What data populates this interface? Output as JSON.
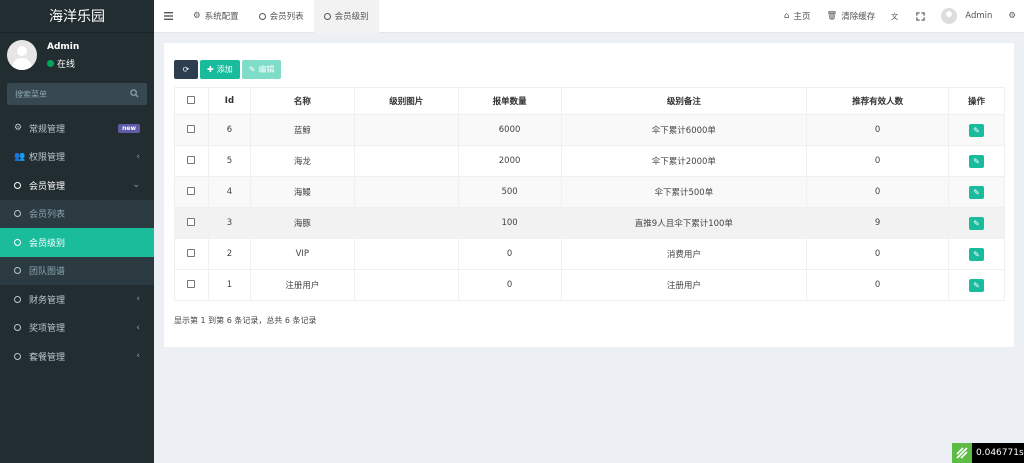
{
  "brand": "海洋乐园",
  "user": {
    "name": "Admin",
    "status": "在线"
  },
  "search": {
    "placeholder": "搜索菜单"
  },
  "menu": [
    {
      "label": "常规管理",
      "icon": "gears-icon",
      "badge": "new"
    },
    {
      "label": "权限管理",
      "icon": "group-icon",
      "arrow": "‹"
    },
    {
      "label": "会员管理",
      "icon": "circle-icon",
      "arrow": "⌄"
    },
    {
      "label": "会员列表",
      "icon": "circle-icon"
    },
    {
      "label": "会员级别",
      "icon": "circle-icon"
    },
    {
      "label": "团队图谱",
      "icon": "circle-icon"
    },
    {
      "label": "财务管理",
      "icon": "circle-icon",
      "arrow": "‹"
    },
    {
      "label": "奖项管理",
      "icon": "circle-icon",
      "arrow": "‹"
    },
    {
      "label": "套餐管理",
      "icon": "circle-icon",
      "arrow": "‹"
    }
  ],
  "tabs": [
    {
      "label": "系统配置"
    },
    {
      "label": "会员列表"
    },
    {
      "label": "会员级别"
    }
  ],
  "topright": {
    "home": "主页",
    "clear_cache": "清除缓存",
    "admin": "Admin"
  },
  "toolbar": {
    "add": "添加",
    "edit": "编辑"
  },
  "table": {
    "headers": [
      "Id",
      "名称",
      "级别图片",
      "报单数量",
      "级别备注",
      "推荐有效人数",
      "操作"
    ],
    "rows": [
      {
        "id": "6",
        "name": "蓝鲸",
        "img": "",
        "qty": "6000",
        "note": "伞下累计6000单",
        "refs": "0"
      },
      {
        "id": "5",
        "name": "海龙",
        "img": "",
        "qty": "2000",
        "note": "伞下累计2000单",
        "refs": "0"
      },
      {
        "id": "4",
        "name": "海鳗",
        "img": "",
        "qty": "500",
        "note": "伞下累计500单",
        "refs": "0"
      },
      {
        "id": "3",
        "name": "海豚",
        "img": "",
        "qty": "100",
        "note": "直推9人且伞下累计100单",
        "refs": "9"
      },
      {
        "id": "2",
        "name": "VIP",
        "img": "",
        "qty": "0",
        "note": "消费用户",
        "refs": "0"
      },
      {
        "id": "1",
        "name": "注册用户",
        "img": "",
        "qty": "0",
        "note": "注册用户",
        "refs": "0"
      }
    ]
  },
  "pager": "显示第 1 到第 6 条记录，总共 6 条记录",
  "perf": "0.046771s"
}
